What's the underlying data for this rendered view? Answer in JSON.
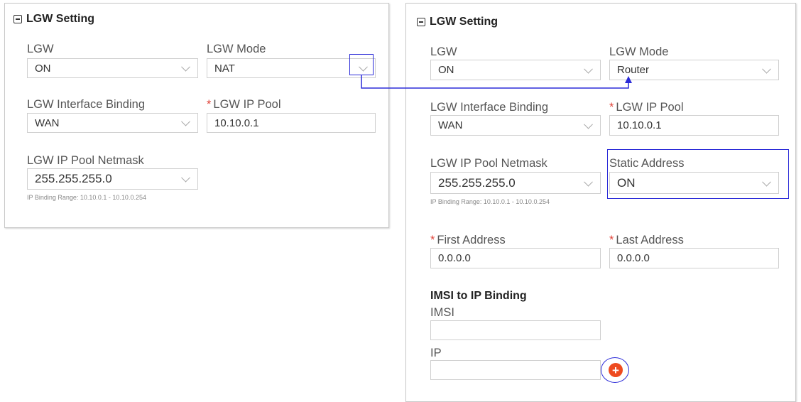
{
  "left_panel": {
    "title": "LGW Setting",
    "lgw": {
      "label": "LGW",
      "value": "ON"
    },
    "lgw_mode": {
      "label": "LGW Mode",
      "value": "NAT"
    },
    "interface_binding": {
      "label": "LGW Interface Binding",
      "value": "WAN"
    },
    "ip_pool": {
      "required_mark": "*",
      "label": "LGW IP Pool",
      "value": "10.10.0.1"
    },
    "ip_pool_netmask": {
      "label": "LGW IP Pool Netmask",
      "value": "255.255.255.0"
    },
    "binding_range_hint": "IP Binding Range: 10.10.0.1 - 10.10.0.254"
  },
  "right_panel": {
    "title": "LGW Setting",
    "lgw": {
      "label": "LGW",
      "value": "ON"
    },
    "lgw_mode": {
      "label": "LGW Mode",
      "value": "Router"
    },
    "interface_binding": {
      "label": "LGW Interface Binding",
      "value": "WAN"
    },
    "ip_pool": {
      "required_mark": "*",
      "label": "LGW IP Pool",
      "value": "10.10.0.1"
    },
    "ip_pool_netmask": {
      "label": "LGW IP Pool Netmask",
      "value": "255.255.255.0"
    },
    "binding_range_hint": "IP Binding Range: 10.10.0.1 - 10.10.0.254",
    "static_address": {
      "label": "Static Address",
      "value": "ON"
    },
    "first_address": {
      "required_mark": "*",
      "label": "First Address",
      "value": "0.0.0.0"
    },
    "last_address": {
      "required_mark": "*",
      "label": "Last Address",
      "value": "0.0.0.0"
    },
    "imsi_binding": {
      "title": "IMSI to IP Binding",
      "imsi_label": "IMSI",
      "imsi_value": "",
      "ip_label": "IP",
      "ip_value": "",
      "add_symbol": "+"
    }
  },
  "colors": {
    "annotation": "#2b2bd8",
    "required_mark": "#e0443a",
    "add_button": "#ee4a1f"
  },
  "icons": [
    "collapse-icon",
    "chevron-down-icon",
    "add-icon"
  ]
}
